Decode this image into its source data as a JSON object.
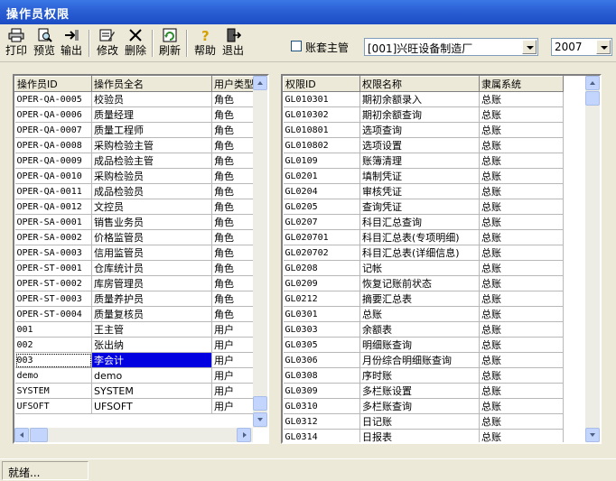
{
  "window": {
    "title": "操作员权限"
  },
  "toolbar": {
    "print": "打印",
    "preview": "预览",
    "export": "输出",
    "modify": "修改",
    "delete": "删除",
    "refresh": "刷新",
    "help": "帮助",
    "exit": "退出"
  },
  "filters": {
    "master_label": "账套主管",
    "master_checked": false,
    "account_set": "[001]兴旺设备制造厂",
    "year": "2007"
  },
  "operators": {
    "headers": [
      "操作员ID",
      "操作员全名",
      "用户类型"
    ],
    "rows": [
      [
        "OPER-QA-0005",
        "校验员",
        "角色"
      ],
      [
        "OPER-QA-0006",
        "质量经理",
        "角色"
      ],
      [
        "OPER-QA-0007",
        "质量工程师",
        "角色"
      ],
      [
        "OPER-QA-0008",
        "采购检验主管",
        "角色"
      ],
      [
        "OPER-QA-0009",
        "成品检验主管",
        "角色"
      ],
      [
        "OPER-QA-0010",
        "采购检验员",
        "角色"
      ],
      [
        "OPER-QA-0011",
        "成品检验员",
        "角色"
      ],
      [
        "OPER-QA-0012",
        "文控员",
        "角色"
      ],
      [
        "OPER-SA-0001",
        "销售业务员",
        "角色"
      ],
      [
        "OPER-SA-0002",
        "价格监管员",
        "角色"
      ],
      [
        "OPER-SA-0003",
        "信用监管员",
        "角色"
      ],
      [
        "OPER-ST-0001",
        "仓库统计员",
        "角色"
      ],
      [
        "OPER-ST-0002",
        "库房管理员",
        "角色"
      ],
      [
        "OPER-ST-0003",
        "质量养护员",
        "角色"
      ],
      [
        "OPER-ST-0004",
        "质量复核员",
        "角色"
      ],
      [
        "001",
        "王主管",
        "用户"
      ],
      [
        "002",
        "张出纳",
        "用户"
      ],
      [
        "003",
        "李会计",
        "用户"
      ],
      [
        "demo",
        "demo",
        "用户"
      ],
      [
        "SYSTEM",
        "SYSTEM",
        "用户"
      ],
      [
        "UFSOFT",
        "UFSOFT",
        "用户"
      ]
    ],
    "selected_index": 17
  },
  "permissions": {
    "headers": [
      "权限ID",
      "权限名称",
      "隶属系统"
    ],
    "rows": [
      [
        "GL010301",
        "期初余额录入",
        "总账"
      ],
      [
        "GL010302",
        "期初余额查询",
        "总账"
      ],
      [
        "GL010801",
        "选项查询",
        "总账"
      ],
      [
        "GL010802",
        "选项设置",
        "总账"
      ],
      [
        "GL0109",
        "账簿清理",
        "总账"
      ],
      [
        "GL0201",
        "填制凭证",
        "总账"
      ],
      [
        "GL0204",
        "审核凭证",
        "总账"
      ],
      [
        "GL0205",
        "查询凭证",
        "总账"
      ],
      [
        "GL0207",
        "科目汇总查询",
        "总账"
      ],
      [
        "GL020701",
        "科目汇总表(专项明细)",
        "总账"
      ],
      [
        "GL020702",
        "科目汇总表(详细信息)",
        "总账"
      ],
      [
        "GL0208",
        "记帐",
        "总账"
      ],
      [
        "GL0209",
        "恢复记账前状态",
        "总账"
      ],
      [
        "GL0212",
        "摘要汇总表",
        "总账"
      ],
      [
        "GL0301",
        "总账",
        "总账"
      ],
      [
        "GL0303",
        "余额表",
        "总账"
      ],
      [
        "GL0305",
        "明细账查询",
        "总账"
      ],
      [
        "GL0306",
        "月份综合明细账查询",
        "总账"
      ],
      [
        "GL0308",
        "序时账",
        "总账"
      ],
      [
        "GL0309",
        "多栏账设置",
        "总账"
      ],
      [
        "GL0310",
        "多栏账查询",
        "总账"
      ],
      [
        "GL0312",
        "日记账",
        "总账"
      ],
      [
        "GL0314",
        "日报表",
        "总账"
      ]
    ]
  },
  "status": {
    "text": "就绪..."
  }
}
